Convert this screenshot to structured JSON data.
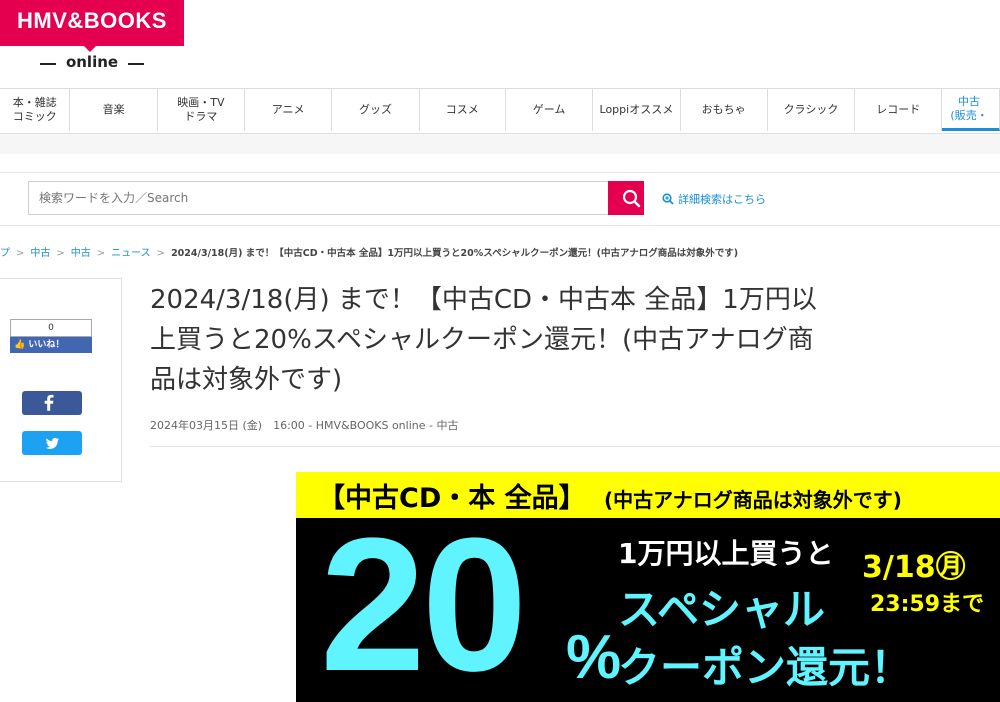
{
  "logo": {
    "brand": "HMV&BOOKS",
    "sub": "online"
  },
  "nav": [
    {
      "label": "本・雑誌\nコミック"
    },
    {
      "label": "音楽"
    },
    {
      "label": "映画・TV\nドラマ"
    },
    {
      "label": "アニメ"
    },
    {
      "label": "グッズ"
    },
    {
      "label": "コスメ"
    },
    {
      "label": "ゲーム"
    },
    {
      "label": "Loppiオススメ"
    },
    {
      "label": "おもちゃ"
    },
    {
      "label": "クラシック"
    },
    {
      "label": "レコード"
    },
    {
      "label": "中古\n(販売・"
    }
  ],
  "search": {
    "placeholder": "検索ワードを入力／Search",
    "advanced_label": "詳細検索はこちら"
  },
  "breadcrumb": {
    "items": [
      "プ",
      "中古",
      "中古",
      "ニュース"
    ],
    "current": "2024/3/18(月) まで！【中古CD・中古本 全品】1万円以上買うと20%スペシャルクーポン還元！(中古アナログ商品は対象外です)"
  },
  "share": {
    "like_count": "0",
    "like_label": "いいね！"
  },
  "article": {
    "title_lines": [
      "2024/3/18(月) まで！【中古CD・中古本 全品】1万円以",
      "上買うと20%スペシャルクーポン還元！(中古アナログ商",
      "品は対象外です)"
    ],
    "meta": "2024年03月15日 (金)　16:00 - HMV&BOOKS online - 中古"
  },
  "banner": {
    "top_main": "【中古CD・本 全品】",
    "top_sub": "(中古アナログ商品は対象外です)",
    "big": "20",
    "percent": "%",
    "line1": "1万円以上買うと",
    "line2": "スペシャル",
    "line3": "クーポン還元！",
    "date": "3/18㊊",
    "time": "23:59まで"
  },
  "colors": {
    "brand": "#e4004f",
    "link": "#1a8fd6",
    "banner_yellow": "#ffff00",
    "banner_cyan": "#5ff4ff"
  }
}
